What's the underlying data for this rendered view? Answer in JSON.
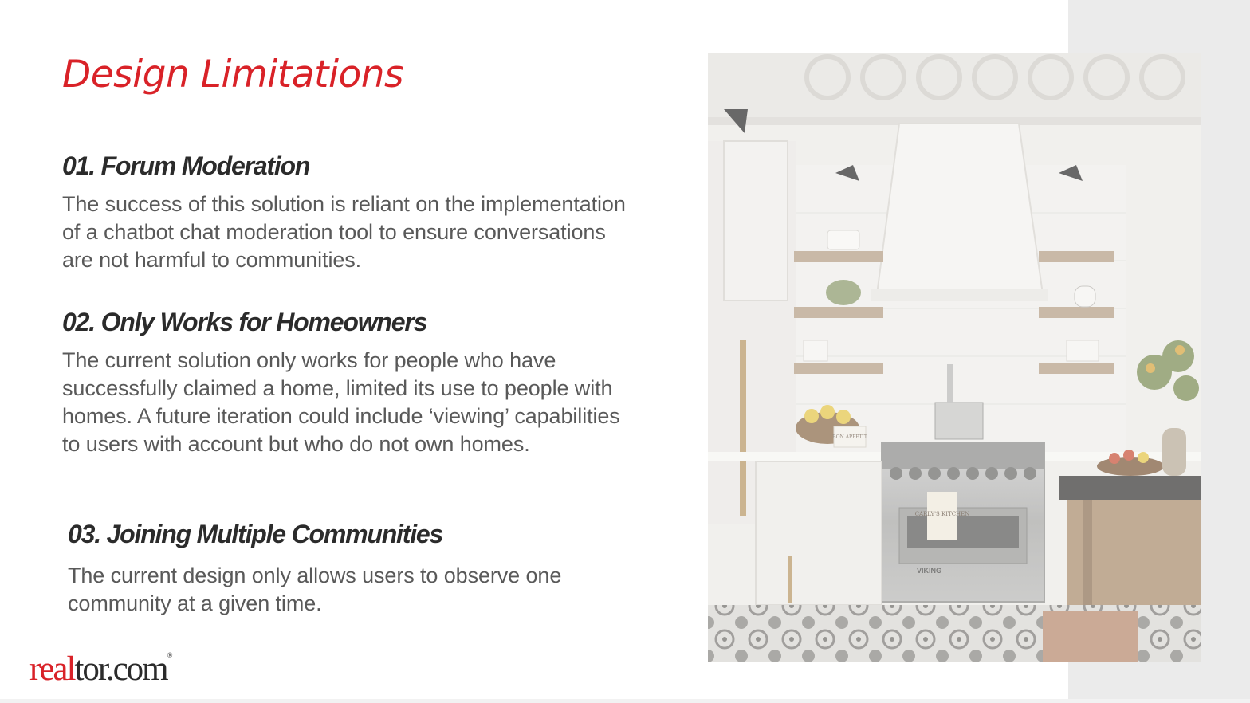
{
  "title": "Design Limitations",
  "sections": [
    {
      "heading": "01. Forum Moderation",
      "body": "The success of this solution is reliant on the implementation of a chatbot chat moderation tool to ensure conversations are not harmful to communities."
    },
    {
      "heading": "02. Only Works for Homeowners",
      "body": "The current solution only works for people who have successfully claimed a home, limited its use to people with homes. A future iteration could include ‘viewing’ capabilities to users with account but who do not own homes."
    },
    {
      "heading": "03. Joining Multiple Communities",
      "body": "The current design only allows users to observe one community at a given time."
    }
  ],
  "logo": {
    "part1": "real",
    "part2": "tor.com",
    "mark": "®"
  },
  "image": {
    "subject": "kitchen-photo",
    "labels": {
      "sign": "BON APPETIT",
      "towel": "CARLY'S KITCHEN",
      "brand": "VIKING"
    }
  },
  "colors": {
    "accent": "#d92228",
    "heading": "#2b2b2b",
    "body": "#595959",
    "band": "#ebebeb"
  }
}
